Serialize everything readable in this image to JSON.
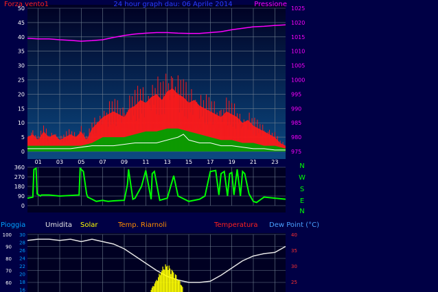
{
  "colors": {
    "background": "#000045",
    "plot_top": "#000022",
    "plot_bottom": "#0c4a82",
    "grid": "#6f7f8f",
    "axis_text": "#ffffff",
    "wind": "#ff1a1a",
    "wind_avg": "#00a000",
    "wind_low": "#ffffff",
    "pressure": "#ff00ff",
    "title": "#2a3cff",
    "direction": "#00ff00",
    "rain": "#00a0ff",
    "humidity": "#e6e6e6",
    "solar": "#ffff00",
    "temp_riarnoli": "#ff8c00",
    "temperatura": "#ff2020",
    "dew_point": "#4aa0ff",
    "humidity_axis": "#00a0ff",
    "temp_axis": "#ff3030"
  },
  "chart_data": [
    {
      "type": "line",
      "title": "24 hour graph dau: 06 Aprile 2014",
      "ylabel_left": "Forza vento1",
      "ylabel_right": "Pressione",
      "ylim_left": [
        0,
        50
      ],
      "yticks_left": [
        "0",
        "5",
        "10",
        "15",
        "20",
        "25",
        "30",
        "35",
        "40",
        "45",
        "50"
      ],
      "ylim_right": [
        975,
        1025
      ],
      "yticks_right": [
        "975",
        "980",
        "985",
        "990",
        "995",
        "1000",
        "1005",
        "1010",
        "1015",
        "1020",
        "1025"
      ],
      "xlim": [
        0,
        24
      ],
      "xticks": [
        "01",
        "03",
        "05",
        "07",
        "09",
        "11",
        "13",
        "15",
        "17",
        "19",
        "21",
        "23"
      ],
      "series": [
        {
          "key": "wind_gust",
          "x": [
            0,
            0.5,
            1,
            1.5,
            2,
            2.5,
            3,
            3.5,
            4,
            4.5,
            5,
            5.5,
            6,
            6.5,
            7,
            7.5,
            8,
            8.5,
            9,
            9.5,
            10,
            10.5,
            11,
            11.5,
            12,
            12.5,
            13,
            13.5,
            14,
            14.5,
            15,
            15.5,
            16,
            16.5,
            17,
            17.5,
            18,
            18.5,
            19,
            19.5,
            20,
            20.5,
            21,
            21.5,
            22,
            22.5,
            23,
            23.5,
            24
          ],
          "y": [
            5,
            6,
            4,
            7,
            5,
            6,
            4,
            5,
            6,
            5,
            7,
            4,
            8,
            10,
            12,
            13,
            14,
            13,
            12,
            15,
            16,
            18,
            17,
            19,
            20,
            18,
            21,
            22,
            20,
            19,
            17,
            18,
            16,
            15,
            14,
            13,
            12,
            14,
            13,
            12,
            10,
            11,
            9,
            8,
            7,
            6,
            5,
            3,
            2
          ]
        },
        {
          "key": "wind_avg",
          "x": [
            0,
            1,
            2,
            3,
            4,
            5,
            6,
            7,
            8,
            9,
            10,
            11,
            12,
            13,
            14,
            15,
            16,
            17,
            18,
            19,
            20,
            21,
            22,
            23,
            24
          ],
          "y": [
            2,
            2,
            2,
            2,
            2,
            2,
            3,
            5,
            5,
            5,
            6,
            7,
            7,
            8,
            8,
            7,
            6,
            5,
            4,
            4,
            3,
            3,
            2,
            2,
            1
          ]
        },
        {
          "key": "wind_low",
          "x": [
            0,
            2,
            4,
            6,
            8,
            10,
            12,
            14,
            14.5,
            15,
            16,
            17,
            18,
            19,
            20,
            21,
            22,
            23,
            24
          ],
          "y": [
            1,
            1,
            1,
            2,
            2,
            3,
            3,
            5,
            6,
            4,
            3,
            3,
            2,
            2,
            1.5,
            1,
            1,
            0.5,
            0.5
          ]
        },
        {
          "key": "pressure",
          "axis": "right",
          "x": [
            0,
            1,
            2,
            3,
            4,
            5,
            6,
            7,
            8,
            9,
            10,
            11,
            12,
            13,
            14,
            15,
            16,
            17,
            18,
            19,
            20,
            21,
            22,
            23,
            24
          ],
          "y": [
            1014.5,
            1014.3,
            1014.3,
            1014.0,
            1013.8,
            1013.5,
            1013.7,
            1014.0,
            1014.8,
            1015.5,
            1016.0,
            1016.3,
            1016.5,
            1016.5,
            1016.3,
            1016.2,
            1016.2,
            1016.5,
            1016.8,
            1017.5,
            1018.0,
            1018.5,
            1018.7,
            1019.0,
            1019.2
          ]
        }
      ]
    },
    {
      "type": "line",
      "title": "",
      "ylim": [
        0,
        360
      ],
      "yticks": [
        "0",
        "90",
        "180",
        "270",
        "360"
      ],
      "direction_labels": [
        "N",
        "W",
        "S",
        "E",
        "N"
      ],
      "series": [
        {
          "key": "wind_direction",
          "x": [
            0,
            0.5,
            0.6,
            0.8,
            0.9,
            1.2,
            1.3,
            2,
            3,
            4.8,
            4.9,
            5.2,
            5.5,
            5.6,
            6,
            6.4,
            7,
            7.2,
            7.5,
            8,
            9,
            9.3,
            9.4,
            9.8,
            10,
            10.6,
            11,
            11.5,
            11.6,
            11.8,
            12.3,
            13,
            13.6,
            14,
            15,
            16,
            16.5,
            17,
            17.5,
            17.8,
            18,
            18.3,
            18.6,
            18.8,
            19,
            19.2,
            19.5,
            19.8,
            20,
            20.2,
            20.6,
            21,
            21.3,
            22,
            23,
            24
          ],
          "y": [
            70,
            80,
            340,
            350,
            110,
            90,
            100,
            100,
            90,
            100,
            350,
            320,
            110,
            80,
            60,
            40,
            50,
            45,
            40,
            45,
            50,
            200,
            340,
            60,
            70,
            180,
            330,
            60,
            300,
            320,
            50,
            70,
            280,
            90,
            40,
            60,
            90,
            320,
            330,
            100,
            300,
            320,
            90,
            300,
            310,
            100,
            340,
            90,
            320,
            300,
            110,
            40,
            30,
            80,
            70,
            60
          ]
        }
      ]
    },
    {
      "type": "line",
      "title": "",
      "legend": [
        "Pioggia",
        "Umidita",
        "Solar",
        "Temp. Riarnoli",
        "Temperatura",
        "Dew Point (°C)"
      ],
      "ylim_rain": [
        0,
        30
      ],
      "yticks_rain": [
        "100",
        "90",
        "80",
        "70",
        "60"
      ],
      "yticks_humidity": [
        "30",
        "28",
        "26",
        "24",
        "22",
        "20",
        "18",
        "16"
      ],
      "ylim_temp": [
        20,
        40
      ],
      "yticks_temp": [
        "40",
        "35",
        "30",
        "25"
      ],
      "series": [
        {
          "key": "humidity",
          "x": [
            0,
            1,
            2,
            3,
            4,
            5,
            6,
            7,
            8,
            9,
            10,
            11,
            12,
            13,
            14,
            15,
            16,
            17,
            18,
            19,
            20,
            21,
            22,
            23,
            24
          ],
          "y": [
            95,
            96,
            96,
            95,
            96,
            94,
            96,
            94,
            92,
            88,
            82,
            76,
            70,
            65,
            62,
            60,
            60,
            61,
            66,
            72,
            78,
            82,
            84,
            85,
            90
          ]
        },
        {
          "key": "solar",
          "x": [
            11.5,
            12,
            12.5,
            13,
            13.5,
            14,
            14.5
          ],
          "y": [
            10,
            40,
            80,
            95,
            70,
            50,
            10
          ]
        }
      ]
    }
  ]
}
